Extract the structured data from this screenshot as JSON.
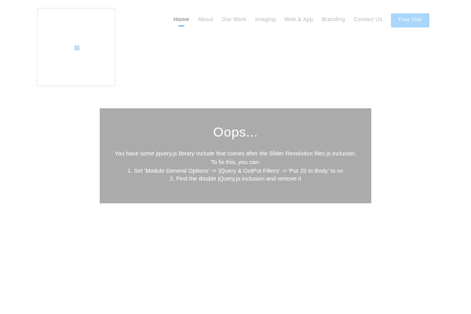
{
  "header": {
    "logo_icon": "broken-image-icon",
    "nav": [
      {
        "label": "Home",
        "active": true
      },
      {
        "label": "About",
        "active": false
      },
      {
        "label": "Our Work",
        "active": false
      },
      {
        "label": "Imaging",
        "active": false
      },
      {
        "label": "Web & App",
        "active": false
      },
      {
        "label": "Branding",
        "active": false
      },
      {
        "label": "Contact Us",
        "active": false
      }
    ],
    "cta_label": "Free Trial",
    "colors": {
      "accent": "#a9d6fa",
      "nav_text": "#b9b9b9",
      "active_underline": "#8ac4ee"
    }
  },
  "slider_error": {
    "title": "Oops...",
    "lines": [
      "You have some jquery.js library include that comes after the Slider Revolution files js inclusion.",
      "To fix this, you can:",
      "1. Set 'Module General Options' -> 'jQuery & OutPut Filters' -> 'Put JS to Body' to on",
      "2. Find the double jQuery.js inclusion and remove it"
    ],
    "background": "#ababab"
  }
}
